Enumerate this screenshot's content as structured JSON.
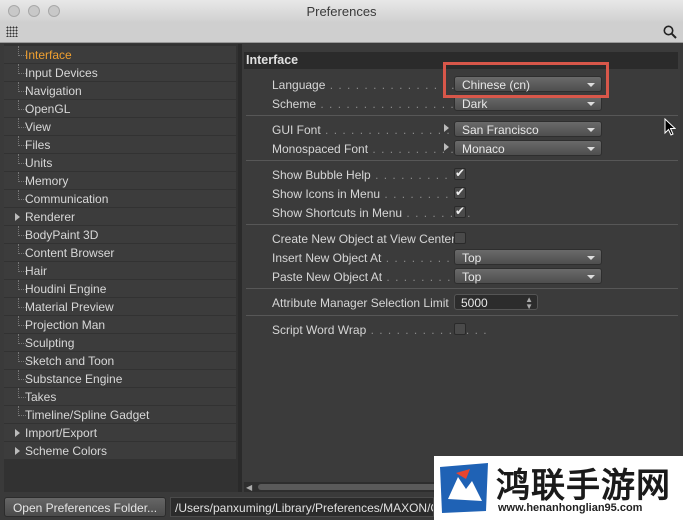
{
  "window": {
    "title": "Preferences"
  },
  "sidebar": {
    "items": [
      {
        "label": "Interface",
        "active": true,
        "expandable": false
      },
      {
        "label": "Input Devices",
        "expandable": false
      },
      {
        "label": "Navigation",
        "expandable": false
      },
      {
        "label": "OpenGL",
        "expandable": false
      },
      {
        "label": "View",
        "expandable": false
      },
      {
        "label": "Files",
        "expandable": false
      },
      {
        "label": "Units",
        "expandable": false
      },
      {
        "label": "Memory",
        "expandable": false
      },
      {
        "label": "Communication",
        "expandable": false
      },
      {
        "label": "Renderer",
        "expandable": true
      },
      {
        "label": "BodyPaint 3D",
        "expandable": false
      },
      {
        "label": "Content Browser",
        "expandable": false
      },
      {
        "label": "Hair",
        "expandable": false
      },
      {
        "label": "Houdini Engine",
        "expandable": false
      },
      {
        "label": "Material Preview",
        "expandable": false
      },
      {
        "label": "Projection Man",
        "expandable": false
      },
      {
        "label": "Sculpting",
        "expandable": false
      },
      {
        "label": "Sketch and Toon",
        "expandable": false
      },
      {
        "label": "Substance Engine",
        "expandable": false
      },
      {
        "label": "Takes",
        "expandable": false
      },
      {
        "label": "Timeline/Spline Gadget",
        "expandable": false
      },
      {
        "label": "Import/Export",
        "expandable": true
      },
      {
        "label": "Scheme Colors",
        "expandable": true
      }
    ]
  },
  "panel": {
    "header": "Interface",
    "language": {
      "label": "Language",
      "dots": " . . . . . . . . . . . . . . . .",
      "value": "Chinese (cn)"
    },
    "scheme": {
      "label": "Scheme",
      "dots": " . . . . . . . . . . . . . . . . .",
      "value": "Dark"
    },
    "gui_font": {
      "label": "GUI Font",
      "dots": " . . . . . . . . . . . . . . .",
      "value": "San Francisco"
    },
    "mono_font": {
      "label": "Monospaced Font",
      "dots": " . . . . . . . . . .",
      "value": "Monaco"
    },
    "bubble_help": {
      "label": "Show Bubble Help",
      "dots": " . . . . . . . . . . .",
      "checked": true
    },
    "show_icons": {
      "label": "Show Icons in Menu",
      "dots": " . . . . . . . . .",
      "checked": true
    },
    "show_shortcuts": {
      "label": "Show Shortcuts in Menu",
      "dots": " . . . . . . . .",
      "checked": true
    },
    "create_new_obj": {
      "label": "Create New Object at View Center",
      "checked": false
    },
    "insert_new_obj": {
      "label": "Insert New Object At",
      "dots": " . . . . . . . . . .",
      "value": "Top"
    },
    "paste_new_obj": {
      "label": "Paste New Object At",
      "dots": " . . . . . . . . . .",
      "value": "Top"
    },
    "attr_limit": {
      "label": "Attribute Manager Selection Limit",
      "value": "5000"
    },
    "script_wrap": {
      "label": "Script Word Wrap",
      "dots": " . . . . . . . . . . . . . .",
      "checked": false
    }
  },
  "bottom": {
    "open_folder_button": "Open Preferences Folder...",
    "path": "/Users/panxuming/Library/Preferences/MAXON/Ci"
  },
  "watermark": {
    "name": "鸿联手游网",
    "url": "www.henanhonglian95.com"
  },
  "colors": {
    "active_item": "#f0a030",
    "highlight_box": "#d8574a"
  }
}
